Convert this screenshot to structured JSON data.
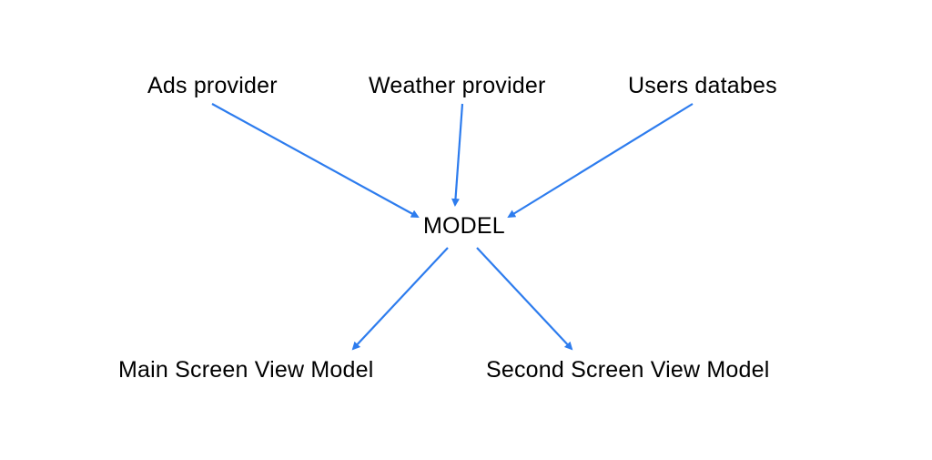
{
  "nodes": {
    "ads_provider": "Ads provider",
    "weather_provider": "Weather provider",
    "users_databes": "Users databes",
    "model": "MODEL",
    "main_screen_vm": "Main Screen View Model",
    "second_screen_vm": "Second Screen View Model"
  },
  "arrow_color": "#2D7CEE"
}
